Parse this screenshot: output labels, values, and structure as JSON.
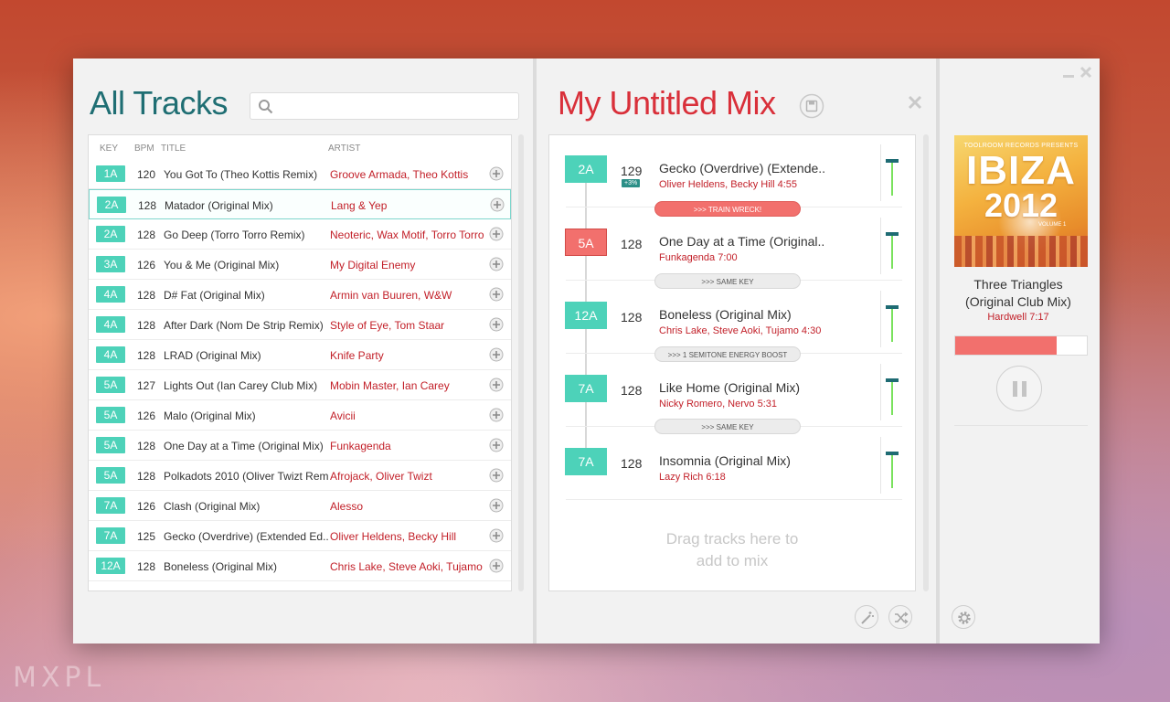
{
  "watermark": "MXPL",
  "library": {
    "title": "All Tracks",
    "search_placeholder": "",
    "columns": {
      "key": "KEY",
      "bpm": "BPM",
      "title": "TITLE",
      "artist": "ARTIST"
    },
    "tracks": [
      {
        "key": "1A",
        "bpm": "120",
        "title": "You Got To (Theo Kottis Remix)",
        "artist": "Groove Armada, Theo Kottis"
      },
      {
        "key": "2A",
        "bpm": "128",
        "title": "Matador (Original Mix)",
        "artist": "Lang & Yep",
        "selected": true
      },
      {
        "key": "2A",
        "bpm": "128",
        "title": "Go Deep (Torro Torro Remix)",
        "artist": "Neoteric, Wax Motif, Torro Torro"
      },
      {
        "key": "3A",
        "bpm": "126",
        "title": "You & Me (Original Mix)",
        "artist": "My Digital Enemy"
      },
      {
        "key": "4A",
        "bpm": "128",
        "title": "D# Fat (Original Mix)",
        "artist": "Armin van Buuren, W&W"
      },
      {
        "key": "4A",
        "bpm": "128",
        "title": "After Dark (Nom De Strip Remix)",
        "artist": "Style of Eye, Tom Staar"
      },
      {
        "key": "4A",
        "bpm": "128",
        "title": "LRAD (Original Mix)",
        "artist": "Knife Party"
      },
      {
        "key": "5A",
        "bpm": "127",
        "title": "Lights Out (Ian Carey Club Mix)",
        "artist": "Mobin Master, Ian Carey"
      },
      {
        "key": "5A",
        "bpm": "126",
        "title": "Malo (Original Mix)",
        "artist": "Avicii"
      },
      {
        "key": "5A",
        "bpm": "128",
        "title": "One Day at a Time (Original Mix)",
        "artist": "Funkagenda"
      },
      {
        "key": "5A",
        "bpm": "128",
        "title": "Polkadots 2010 (Oliver Twizt Rem..",
        "artist": "Afrojack, Oliver Twizt"
      },
      {
        "key": "7A",
        "bpm": "126",
        "title": "Clash (Original Mix)",
        "artist": "Alesso"
      },
      {
        "key": "7A",
        "bpm": "125",
        "title": "Gecko (Overdrive) (Extended Ed..",
        "artist": "Oliver Heldens, Becky Hill"
      },
      {
        "key": "12A",
        "bpm": "128",
        "title": "Boneless (Original Mix)",
        "artist": "Chris Lake, Steve Aoki, Tujamo"
      }
    ]
  },
  "mix": {
    "title": "My Untitled Mix",
    "items": [
      {
        "key": "2A",
        "bpm": "129",
        "boost": "+3%",
        "title": "Gecko (Overdrive) (Extende..",
        "artist_time": "Oliver Heldens, Becky Hill 4:55"
      },
      {
        "key": "5A",
        "bpm": "128",
        "title": "One Day at a Time (Original..",
        "artist_time": "Funkagenda 7:00",
        "clash": true
      },
      {
        "key": "12A",
        "bpm": "128",
        "title": "Boneless (Original Mix)",
        "artist_time": "Chris Lake, Steve Aoki, Tujamo 4:30"
      },
      {
        "key": "7A",
        "bpm": "128",
        "title": "Like Home (Original Mix)",
        "artist_time": "Nicky Romero, Nervo 5:31"
      },
      {
        "key": "7A",
        "bpm": "128",
        "title": "Insomnia (Original Mix)",
        "artist_time": "Lazy Rich 6:18"
      }
    ],
    "transitions": [
      {
        "label": ">>> TRAIN WRECK!",
        "warn": true
      },
      {
        "label": ">>> SAME KEY",
        "warn": false
      },
      {
        "label": ">>> 1 SEMITONE ENERGY BOOST",
        "warn": false
      },
      {
        "label": ">>> SAME KEY",
        "warn": false
      }
    ],
    "drop_hint_line1": "Drag tracks here to",
    "drop_hint_line2": "add to mix"
  },
  "now_playing": {
    "album_label": "TOOLROOM RECORDS PRESENTS",
    "album_line1": "IBIZA",
    "album_line2": "2012",
    "album_volume": "VOLUME 1",
    "title_line1": "Three Triangles",
    "title_line2": "(Original Club Mix)",
    "artist_time": "Hardwell 7:17",
    "progress": 0.77
  },
  "colors": {
    "key_green": "#4dd2b9",
    "key_red": "#f2706d",
    "library_title": "#1f6e73",
    "mix_title": "#d9303a",
    "artist_red": "#c21f28"
  }
}
